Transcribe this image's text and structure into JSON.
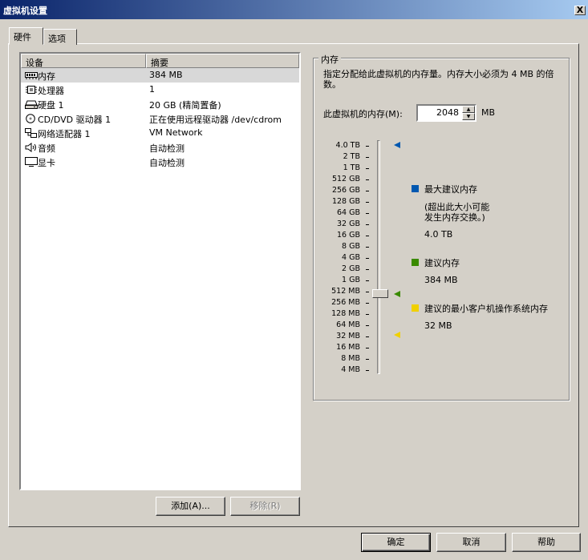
{
  "window": {
    "title": "虚拟机设置",
    "close_label": "X"
  },
  "tabs": [
    {
      "label": "硬件"
    },
    {
      "label": "选项"
    }
  ],
  "device_table": {
    "headers": [
      "设备",
      "摘要"
    ],
    "rows": [
      {
        "icon": "memory-icon",
        "name": "内存",
        "summary": "384 MB"
      },
      {
        "icon": "cpu-icon",
        "name": "处理器",
        "summary": "1"
      },
      {
        "icon": "harddisk-icon",
        "name": "硬盘 1",
        "summary": "20 GB (精简置备)"
      },
      {
        "icon": "cdrom-icon",
        "name": "CD/DVD 驱动器 1",
        "summary": "正在使用远程驱动器 /dev/cdrom"
      },
      {
        "icon": "network-icon",
        "name": "网络适配器 1",
        "summary": "VM Network"
      },
      {
        "icon": "audio-icon",
        "name": "音频",
        "summary": "自动检测"
      },
      {
        "icon": "display-icon",
        "name": "显卡",
        "summary": "自动检测"
      }
    ]
  },
  "list_buttons": {
    "add": "添加(A)...",
    "remove": "移除(R)"
  },
  "memory_panel": {
    "group_title": "内存",
    "description": "指定分配给此虚拟机的内存量。内存大小必须为 4 MB 的倍数。",
    "field_label": "此虚拟机的内存(M):",
    "value": "2048",
    "unit": "MB",
    "scale_ticks": [
      "4.0 TB",
      "2 TB",
      "1 TB",
      "512 GB",
      "256 GB",
      "128 GB",
      "64 GB",
      "32 GB",
      "16 GB",
      "8 GB",
      "4 GB",
      "2 GB",
      "1 GB",
      "512 MB",
      "256 MB",
      "128 MB",
      "64 MB",
      "32 MB",
      "16 MB",
      "8 MB",
      "4 MB"
    ],
    "legend": {
      "max": {
        "title": "最大建议内存",
        "note_line1": "(超出此大小可能",
        "note_line2": "发生内存交换。)",
        "value": "4.0 TB",
        "color": "#0058b0"
      },
      "recommended": {
        "title": "建议内存",
        "value": "384 MB",
        "color": "#3a8a00"
      },
      "min_guest": {
        "title": "建议的最小客户机操作系统内存",
        "value": "32 MB",
        "color": "#f0d000"
      }
    }
  },
  "footer_buttons": {
    "ok": "确定",
    "cancel": "取消",
    "help": "帮助"
  }
}
